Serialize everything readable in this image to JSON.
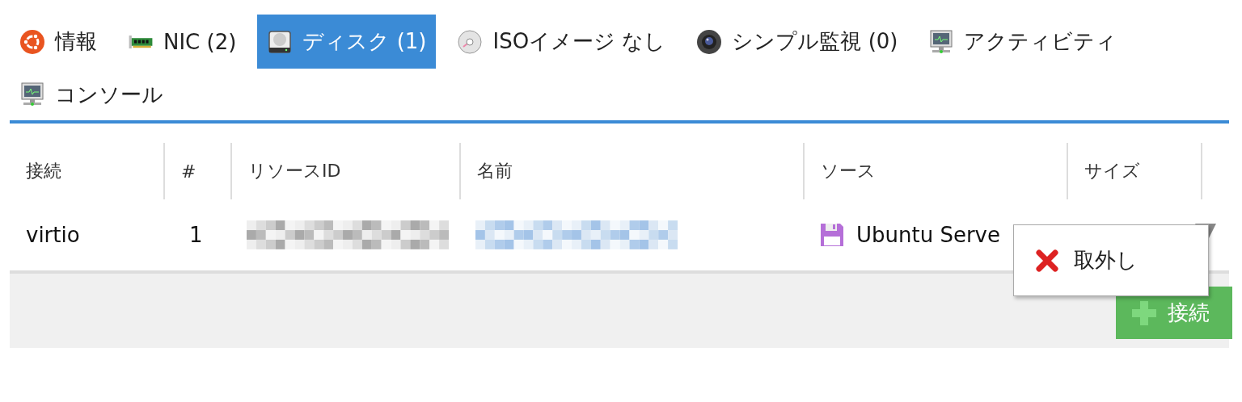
{
  "tabs": [
    {
      "label": "情報",
      "kind": "ubuntu",
      "selected": false
    },
    {
      "label": "NIC (2)",
      "kind": "nic",
      "selected": false
    },
    {
      "label": "ディスク (1)",
      "kind": "disk",
      "selected": true
    },
    {
      "label": "ISOイメージ なし",
      "kind": "cd",
      "selected": false
    },
    {
      "label": "シンプル監視 (0)",
      "kind": "camera",
      "selected": false
    },
    {
      "label": "アクティビティ",
      "kind": "monitor",
      "selected": false
    },
    {
      "label": "コンソール",
      "kind": "monitor",
      "selected": false
    }
  ],
  "table": {
    "columns": [
      "接続",
      "#",
      "リソースID",
      "名前",
      "ソース",
      "サイズ"
    ],
    "rows": [
      {
        "connection": "virtio",
        "number": "1",
        "source": "Ubuntu Serve"
      }
    ]
  },
  "context_menu": {
    "items": [
      {
        "label": "取外し",
        "kind": "remove"
      }
    ]
  },
  "connect_button": {
    "label": "接続"
  }
}
